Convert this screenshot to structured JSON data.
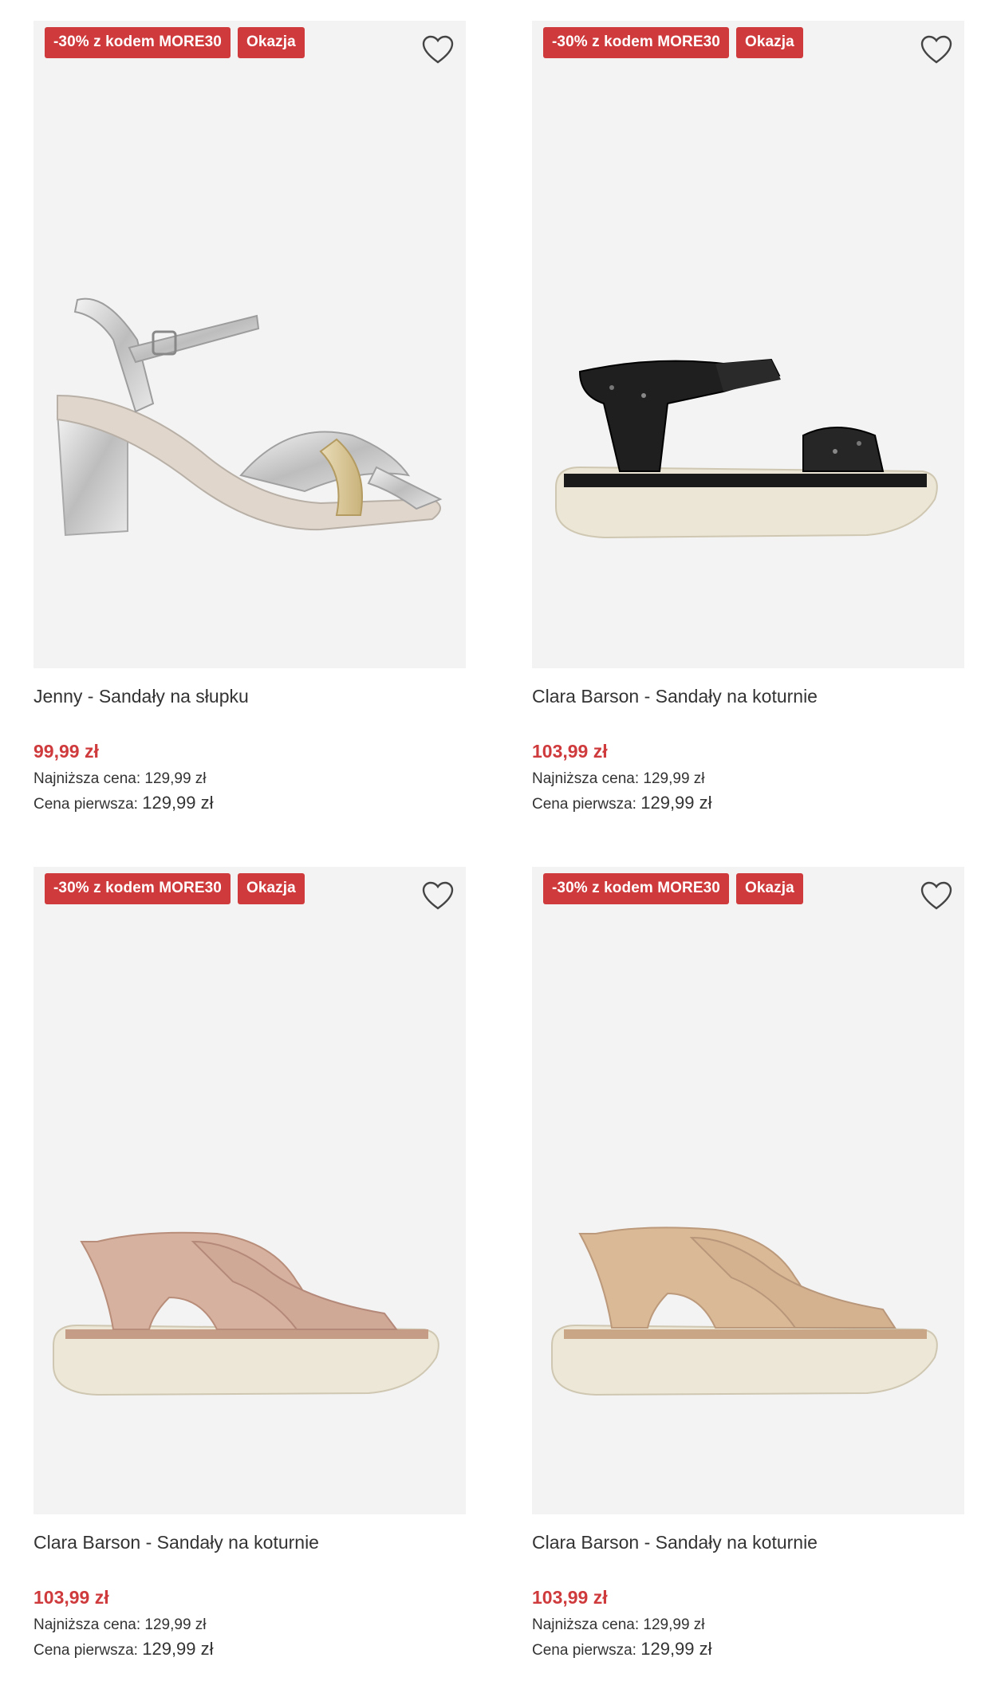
{
  "colors": {
    "badge": "#cf3a3c",
    "price": "#cf3a3c",
    "image_bg": "#f3f3f3"
  },
  "products": [
    {
      "badge_discount": "-30% z kodem MORE30",
      "badge_deal": "Okazja",
      "favorite_icon": "heart-outline-icon",
      "title": "Jenny - Sandały na słupku",
      "price": "99,99 zł",
      "lowest_label": "Najniższa cena:",
      "lowest_value": "129,99 zł",
      "first_label": "Cena pierwsza:",
      "first_value": "129,99 zł",
      "image": "silver block-heel sandal"
    },
    {
      "badge_discount": "-30% z kodem MORE30",
      "badge_deal": "Okazja",
      "favorite_icon": "heart-outline-icon",
      "title": "Clara Barson - Sandały na koturnie",
      "price": "103,99 zł",
      "lowest_label": "Najniższa cena:",
      "lowest_value": "129,99 zł",
      "first_label": "Cena pierwsza:",
      "first_value": "129,99 zł",
      "image": "black sport sandal"
    },
    {
      "badge_discount": "-30% z kodem MORE30",
      "badge_deal": "Okazja",
      "favorite_icon": "heart-outline-icon",
      "title": "Clara Barson - Sandały na koturnie",
      "price": "103,99 zł",
      "lowest_label": "Najniższa cena:",
      "lowest_value": "129,99 zł",
      "first_label": "Cena pierwsza:",
      "first_value": "129,99 zł",
      "image": "pink knit sandal"
    },
    {
      "badge_discount": "-30% z kodem MORE30",
      "badge_deal": "Okazja",
      "favorite_icon": "heart-outline-icon",
      "title": "Clara Barson - Sandały na koturnie",
      "price": "103,99 zł",
      "lowest_label": "Najniższa cena:",
      "lowest_value": "129,99 zł",
      "first_label": "Cena pierwsza:",
      "first_value": "129,99 zł",
      "image": "beige knit sandal"
    }
  ]
}
